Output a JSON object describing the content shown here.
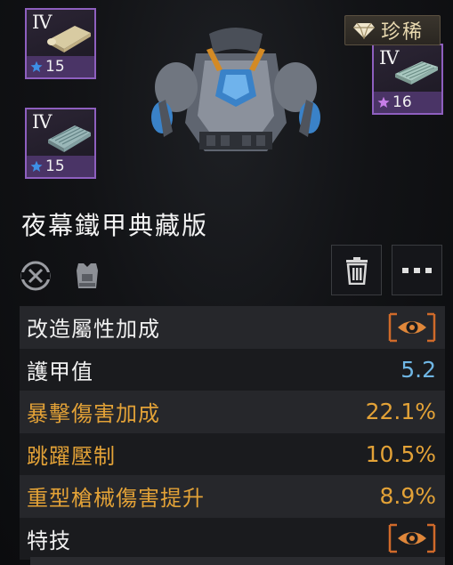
{
  "item": {
    "name": "夜幕鐵甲典藏版",
    "rarity_label": "珍稀"
  },
  "materials": [
    {
      "tier": "IV",
      "level": "15",
      "star_color": "#3d8fe6"
    },
    {
      "tier": "IV",
      "level": "15",
      "star_color": "#3d8fe6"
    },
    {
      "tier": "IV",
      "level": "16",
      "star_color": "#c77ee8"
    }
  ],
  "stats": {
    "mod_bonus_label": "改造屬性加成",
    "rows": [
      {
        "label": "護甲值",
        "value": "5.2"
      },
      {
        "label": "暴擊傷害加成",
        "value": "22.1%"
      },
      {
        "label": "跳躍壓制",
        "value": "10.5%"
      },
      {
        "label": "重型槍械傷害提升",
        "value": "8.9%"
      }
    ],
    "perk_label": "特技"
  },
  "colors": {
    "accent_orange": "#e3a237",
    "value_blue": "#6fb6e4",
    "card_border": "#8e5fbf"
  },
  "icons": {
    "swap": "swap-cancel-icon",
    "vest": "armor-vest-icon",
    "trash": "trash-icon",
    "more": "more-dots-icon",
    "eye": "eye-icon",
    "gem": "diamond-icon"
  }
}
